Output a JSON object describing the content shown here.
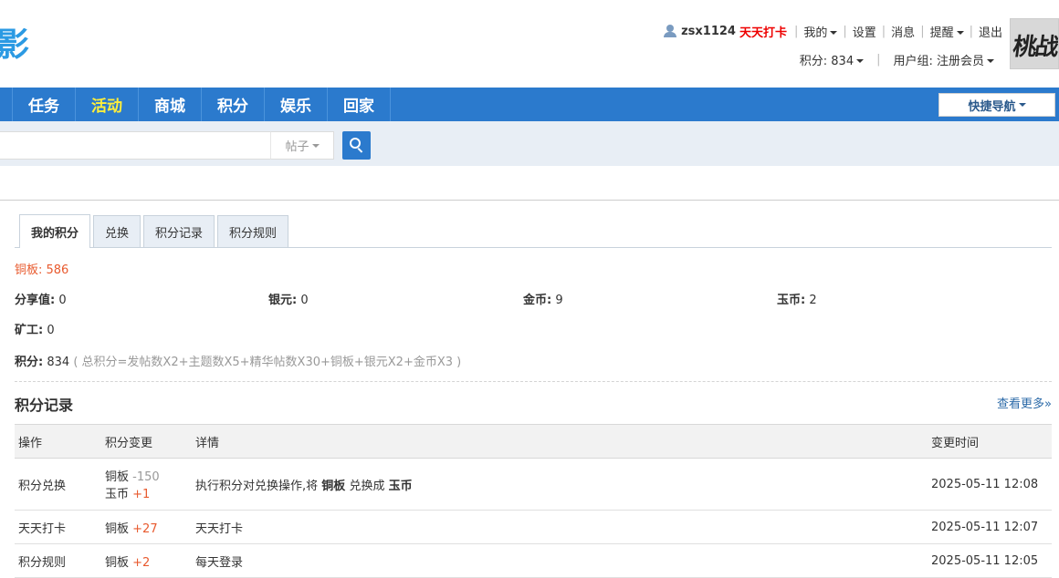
{
  "logo": {
    "text": "影"
  },
  "userbar": {
    "username": "zsx1124",
    "checkin": "天天打卡",
    "my": "我的",
    "settings": "设置",
    "messages": "消息",
    "reminders": "提醒",
    "logout": "退出",
    "points": "积分: 834",
    "usergroup": "用户组: 注册会员"
  },
  "avatar": {
    "text": "桃战"
  },
  "nav": {
    "items": [
      "任务",
      "活动",
      "商城",
      "积分",
      "娱乐",
      "回家"
    ],
    "active_index": 1,
    "quicknav": "快捷导航"
  },
  "search": {
    "placeholder": "",
    "type": "帖子"
  },
  "tabs": [
    "我的积分",
    "兑换",
    "积分记录",
    "积分规则"
  ],
  "summary": {
    "copper": "铜板: 586",
    "share_label": "分享值:",
    "share_value": "0",
    "silver_label": "银元:",
    "silver_value": "0",
    "gold_label": "金币:",
    "gold_value": "9",
    "jade_label": "玉币:",
    "jade_value": "2",
    "miner_label": "矿工:",
    "miner_value": "0",
    "total_label": "积分:",
    "total_value": "834",
    "total_note": "( 总积分=发帖数X2+主题数X5+精华帖数X30+铜板+银元X2+金币X3 )"
  },
  "records": {
    "title": "积分记录",
    "more": "查看更多»",
    "headers": [
      "操作",
      "积分变更",
      "详情",
      "变更时间"
    ],
    "rows": [
      {
        "action": "积分兑换",
        "change1_name": "铜板",
        "change1_delta": "-150",
        "change2_name": "玉币",
        "change2_delta": "+1",
        "detail_pre": "执行积分对兑换操作,将",
        "detail_from": "铜板",
        "detail_mid": "兑换成",
        "detail_to": "玉币",
        "time": "2025-05-11 12:08"
      },
      {
        "action": "天天打卡",
        "change1_name": "铜板",
        "change1_delta": "+27",
        "detail": "天天打卡",
        "time": "2025-05-11 12:07"
      },
      {
        "action": "积分规则",
        "change1_name": "铜板",
        "change1_delta": "+2",
        "detail": "每天登录",
        "time": "2025-05-11 12:05"
      }
    ]
  },
  "colors": {
    "nav_bg": "#2b7acd",
    "nav_active": "#ffef3b",
    "accent_red": "#e85a2e",
    "link_blue": "#2b6aa8"
  }
}
